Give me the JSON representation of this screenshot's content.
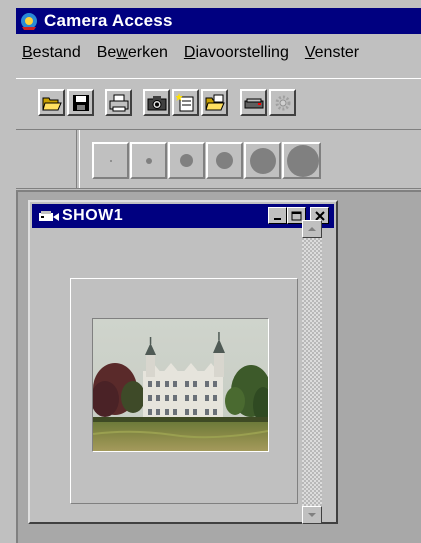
{
  "app": {
    "title": "Camera Access",
    "icon": "camera-access-app-icon",
    "colors": {
      "titlebar": "#000080",
      "face": "#c0c0c0",
      "mdi_background": "#a8a8a8"
    }
  },
  "menu": {
    "items": [
      {
        "pre": "",
        "accel": "B",
        "post": "estand"
      },
      {
        "pre": "Be",
        "accel": "w",
        "post": "erken"
      },
      {
        "pre": "",
        "accel": "D",
        "post": "iavoorstelling"
      },
      {
        "pre": "",
        "accel": "V",
        "post": "enster"
      }
    ]
  },
  "toolbar": {
    "buttons": [
      "open-folder-icon",
      "save-disk-icon",
      "print-icon",
      "camera-icon",
      "new-slide-icon",
      "open-show-icon",
      "scanner-icon",
      "settings-icon"
    ],
    "brush_sizes": [
      "tiny",
      "small",
      "medium",
      "medium-large",
      "large",
      "extra-large"
    ]
  },
  "child_window": {
    "title": "SHOW1",
    "icon": "slideshow-icon",
    "controls": [
      "minimize",
      "maximize",
      "close"
    ]
  }
}
